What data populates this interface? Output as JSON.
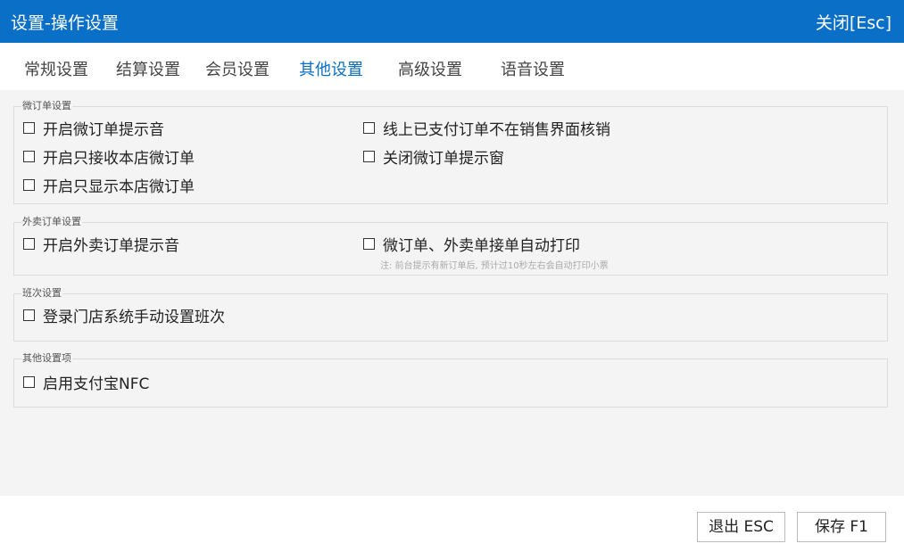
{
  "window": {
    "title": "设置-操作设置",
    "close_label": "关闭[Esc]"
  },
  "tabs": [
    {
      "label": "常规设置",
      "active": false
    },
    {
      "label": "结算设置",
      "active": false
    },
    {
      "label": "会员设置",
      "active": false
    },
    {
      "label": "其他设置",
      "active": true
    },
    {
      "label": "高级设置",
      "active": false
    },
    {
      "label": "语音设置",
      "active": false
    }
  ],
  "groups": {
    "micro_order": {
      "title": "微订单设置",
      "options": [
        {
          "label": "开启微订单提示音",
          "checked": false
        },
        {
          "label": "线上已支付订单不在销售界面核销",
          "checked": false
        },
        {
          "label": "开启只接收本店微订单",
          "checked": false
        },
        {
          "label": "关闭微订单提示窗",
          "checked": false
        },
        {
          "label": "开启只显示本店微订单",
          "checked": false
        }
      ]
    },
    "takeout": {
      "title": "外卖订单设置",
      "options": [
        {
          "label": "开启外卖订单提示音",
          "checked": false
        },
        {
          "label": "微订单、外卖单接单自动打印",
          "checked": false
        }
      ],
      "note": "注: 前台提示有新订单后, 预计过10秒左右会自动打印小票"
    },
    "shift": {
      "title": "班次设置",
      "options": [
        {
          "label": "登录门店系统手动设置班次",
          "checked": false
        }
      ]
    },
    "other": {
      "title": "其他设置项",
      "options": [
        {
          "label": "启用支付宝NFC",
          "checked": false
        }
      ]
    }
  },
  "footer": {
    "exit_label": "退出 ESC",
    "save_label": "保存 F1"
  },
  "colors": {
    "accent": "#0a6fc7",
    "panel_bg": "#f4f4f4",
    "border": "#dcdcdc"
  }
}
